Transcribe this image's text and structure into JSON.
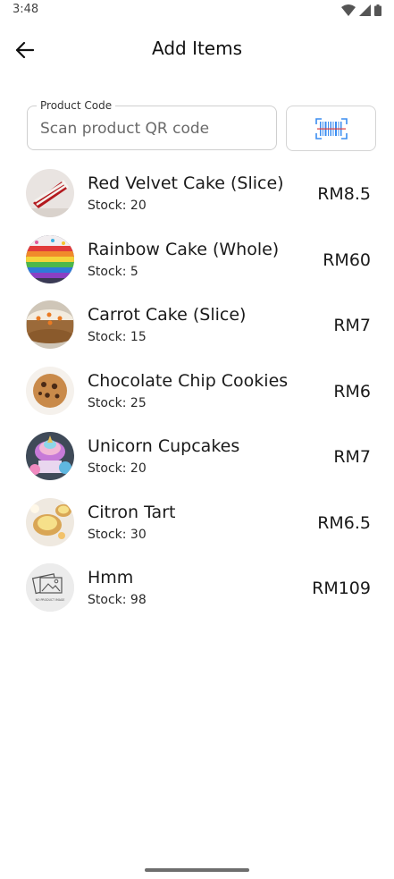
{
  "status_bar": {
    "time": "3:48"
  },
  "header": {
    "title": "Add Items"
  },
  "search": {
    "label": "Product Code",
    "placeholder": "Scan product QR code"
  },
  "products": [
    {
      "name": "Red Velvet Cake (Slice)",
      "stock": "Stock: 20",
      "price": "RM8.5",
      "image": "red-velvet-cake-image"
    },
    {
      "name": "Rainbow Cake (Whole)",
      "stock": "Stock: 5",
      "price": "RM60",
      "image": "rainbow-cake-image"
    },
    {
      "name": "Carrot Cake (Slice)",
      "stock": "Stock: 15",
      "price": "RM7",
      "image": "carrot-cake-image"
    },
    {
      "name": "Chocolate Chip Cookies",
      "stock": "Stock: 25",
      "price": "RM6",
      "image": "cookies-image"
    },
    {
      "name": "Unicorn Cupcakes",
      "stock": "Stock: 20",
      "price": "RM7",
      "image": "cupcakes-image"
    },
    {
      "name": "Citron Tart",
      "stock": "Stock: 30",
      "price": "RM6.5",
      "image": "tart-image"
    },
    {
      "name": "Hmm",
      "stock": "Stock: 98",
      "price": "RM109",
      "image": "no-product-image-placeholder",
      "image_caption": "NO PRODUCT IMAGE"
    }
  ]
}
